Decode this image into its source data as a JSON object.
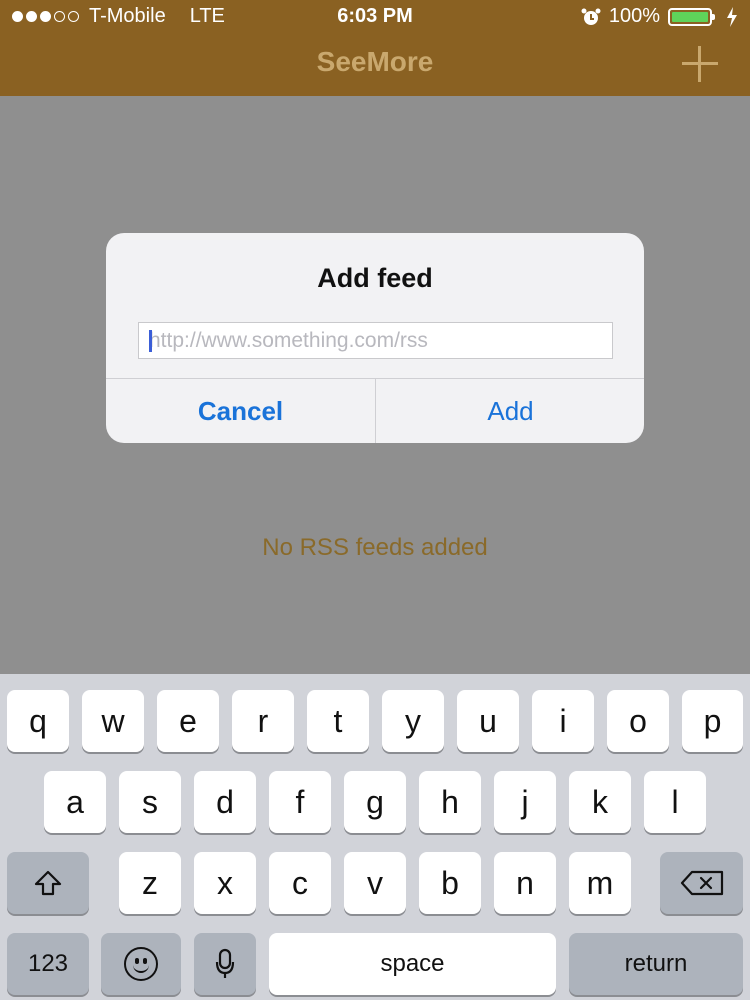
{
  "status_bar": {
    "carrier": "T-Mobile",
    "network": "LTE",
    "time": "6:03 PM",
    "battery": "100%",
    "signal_bars_filled": 3,
    "signal_bars_total": 5,
    "icons": [
      "alarm-icon",
      "battery-icon",
      "charging-bolt-icon"
    ]
  },
  "nav": {
    "title": "SeeMore",
    "add_icon": "plus-icon"
  },
  "content": {
    "empty_message": "No RSS feeds added"
  },
  "alert": {
    "title": "Add feed",
    "input_value": "",
    "input_placeholder": "http://www.something.com/rss",
    "cancel_label": "Cancel",
    "add_label": "Add"
  },
  "keyboard": {
    "row1": [
      "q",
      "w",
      "e",
      "r",
      "t",
      "y",
      "u",
      "i",
      "o",
      "p"
    ],
    "row2": [
      "a",
      "s",
      "d",
      "f",
      "g",
      "h",
      "j",
      "k",
      "l"
    ],
    "row3": [
      "z",
      "x",
      "c",
      "v",
      "b",
      "n",
      "m"
    ],
    "numbers_label": "123",
    "space_label": "space",
    "return_label": "return",
    "icons": [
      "shift-icon",
      "delete-icon",
      "emoji-icon",
      "microphone-icon"
    ]
  },
  "colors": {
    "nav_bar": "#8a6122",
    "accent_text": "#8a6a2a",
    "alert_button": "#1a73d9",
    "battery_fill": "#5fd35a"
  }
}
